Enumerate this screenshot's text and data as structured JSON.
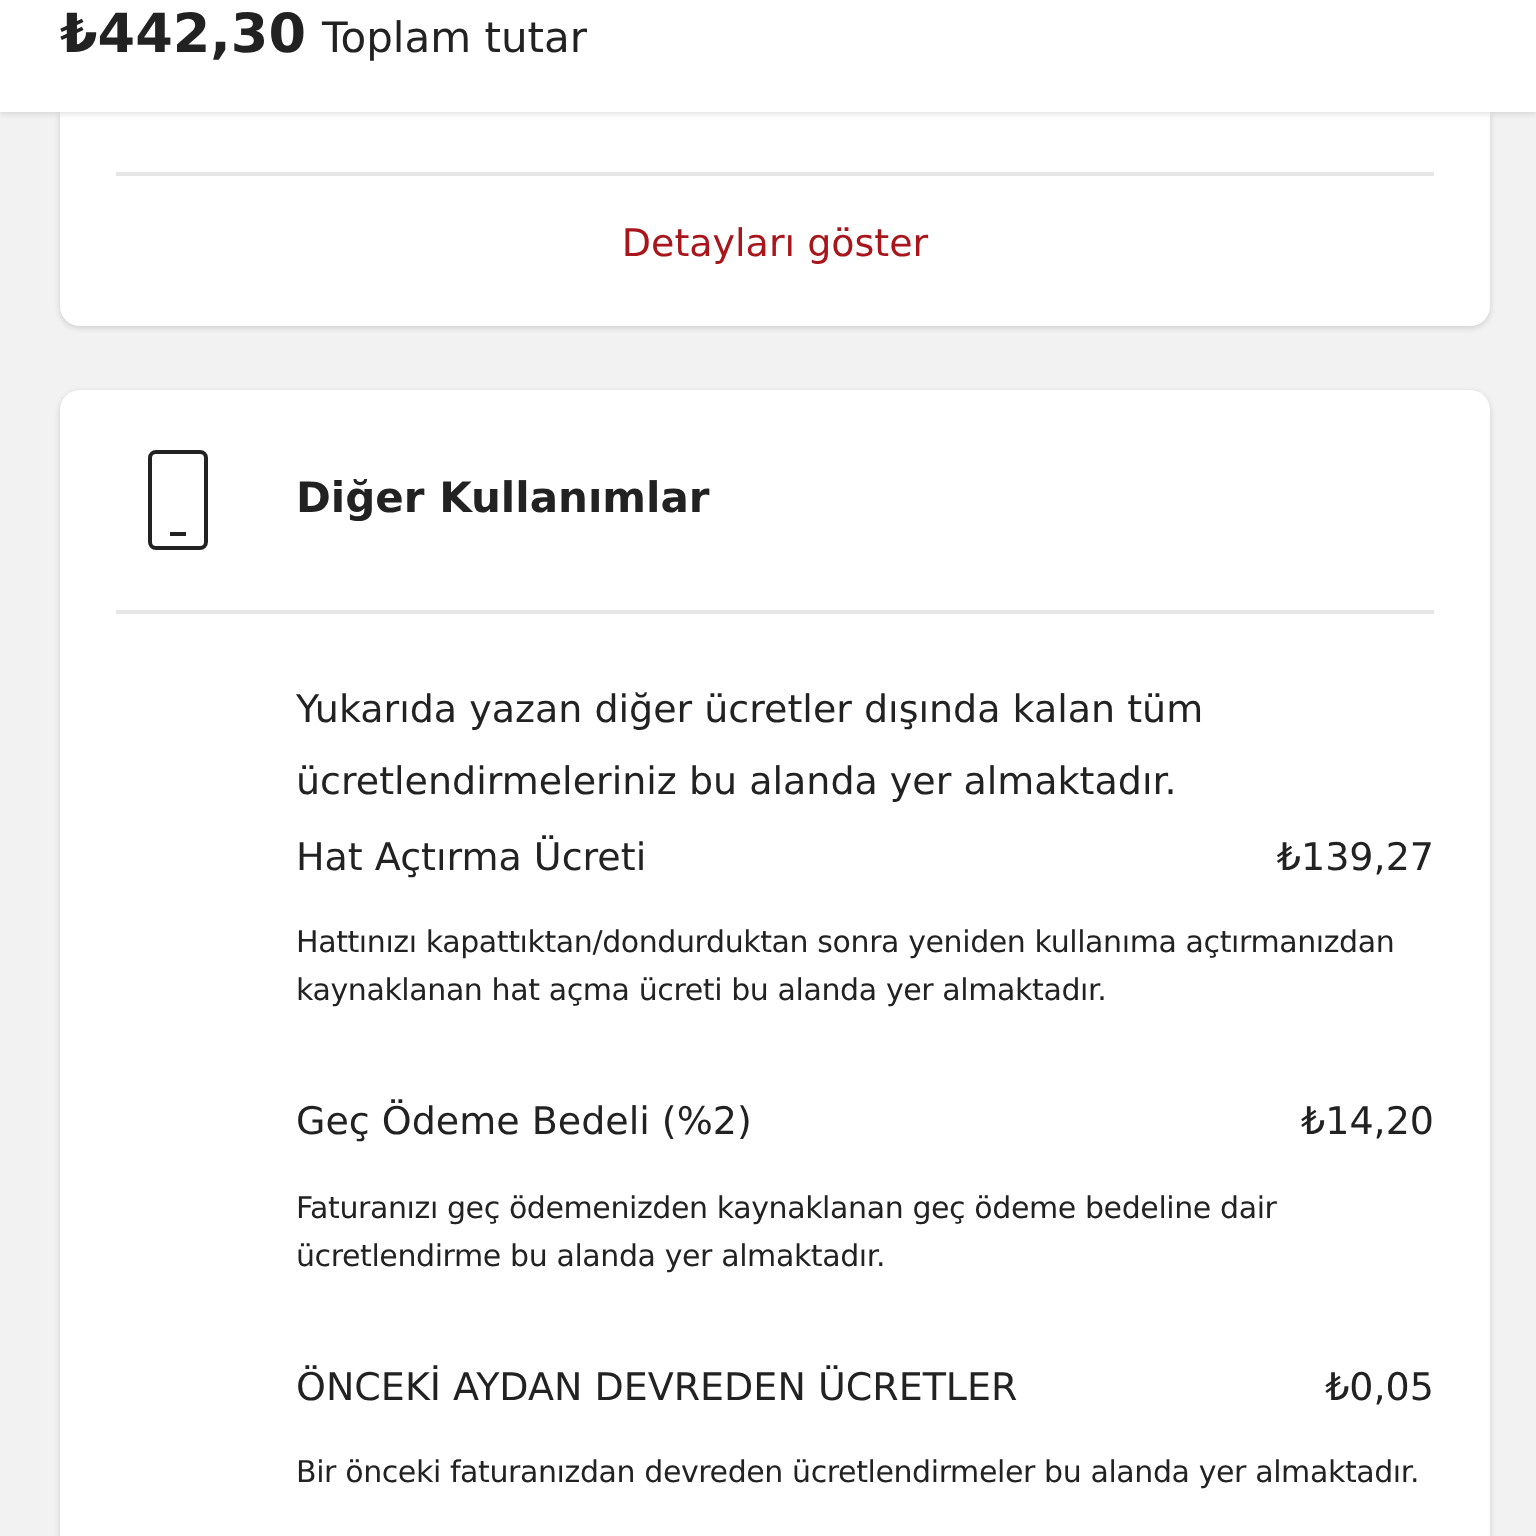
{
  "header": {
    "amount": "₺442,30",
    "label": "Toplam tutar"
  },
  "summary_card": {
    "link": "Detayları göster"
  },
  "section": {
    "title": "Diğer Kullanımlar",
    "description": "Yukarıda yazan diğer ücretler dışında kalan tüm ücretlendirmeleriniz bu alanda yer almaktadır.",
    "items": [
      {
        "name": "Hat Açtırma Ücreti",
        "amount": "₺139,27",
        "note": "Hattınızı kapattıktan/dondurduktan sonra yeniden kullanıma açtırmanızdan kaynaklanan hat açma ücreti bu alanda yer almaktadır."
      },
      {
        "name": "Geç Ödeme Bedeli (%2)",
        "amount": "₺14,20",
        "note": "Faturanızı geç ödemenizden kaynaklanan geç ödeme bedeline dair ücretlendirme bu alanda yer almaktadır."
      },
      {
        "name": "ÖNCEKİ AYDAN DEVREDEN ÜCRETLER",
        "amount": "₺0,05",
        "note": "Bir önceki faturanızdan devreden ücretlendirmeler bu alanda yer almaktadır."
      }
    ]
  }
}
